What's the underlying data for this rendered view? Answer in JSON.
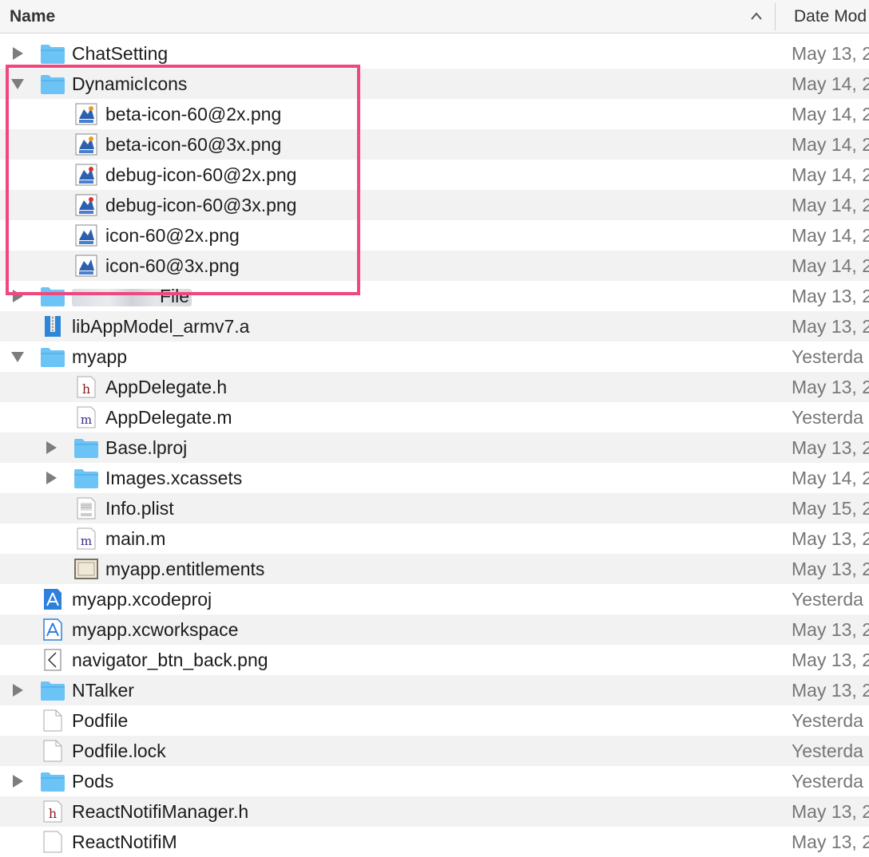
{
  "header": {
    "name_label": "Name",
    "date_label": "Date Mod"
  },
  "rows": [
    {
      "name": "ChatSetting",
      "date": "May 13, 2",
      "icon": "folder-icon",
      "disclosure": "collapsed"
    },
    {
      "name": "DynamicIcons",
      "date": "May 14, 2",
      "icon": "folder-icon",
      "disclosure": "expanded"
    },
    {
      "name": "beta-icon-60@2x.png",
      "date": "May 14, 2",
      "icon": "png-image-icon"
    },
    {
      "name": "beta-icon-60@3x.png",
      "date": "May 14, 2",
      "icon": "png-image-icon"
    },
    {
      "name": "debug-icon-60@2x.png",
      "date": "May 14, 2",
      "icon": "png-image-icon"
    },
    {
      "name": "debug-icon-60@3x.png",
      "date": "May 14, 2",
      "icon": "png-image-icon"
    },
    {
      "name": "icon-60@2x.png",
      "date": "May 14, 2",
      "icon": "png-image-icon"
    },
    {
      "name": "icon-60@3x.png",
      "date": "May 14, 2",
      "icon": "png-image-icon"
    },
    {
      "name": "File",
      "date": "May 13, 2",
      "icon": "folder-icon",
      "disclosure": "collapsed"
    },
    {
      "name": "libAppModel_armv7.a",
      "date": "May 13, 2",
      "icon": "static-library-icon"
    },
    {
      "name": "myapp",
      "date": "Yesterda",
      "icon": "folder-icon",
      "disclosure": "expanded"
    },
    {
      "name": "AppDelegate.h",
      "date": "May 13, 2",
      "icon": "header-file-icon"
    },
    {
      "name": "AppDelegate.m",
      "date": "Yesterda",
      "icon": "objc-source-icon"
    },
    {
      "name": "Base.lproj",
      "date": "May 13, 2",
      "icon": "folder-icon",
      "disclosure": "collapsed"
    },
    {
      "name": "Images.xcassets",
      "date": "May 14, 2",
      "icon": "folder-icon",
      "disclosure": "collapsed"
    },
    {
      "name": "Info.plist",
      "date": "May 15, 2",
      "icon": "plist-file-icon"
    },
    {
      "name": "main.m",
      "date": "May 13, 2",
      "icon": "objc-source-icon"
    },
    {
      "name": "myapp.entitlements",
      "date": "May 13, 2",
      "icon": "entitlements-icon"
    },
    {
      "name": "myapp.xcodeproj",
      "date": "Yesterda",
      "icon": "xcodeproj-icon"
    },
    {
      "name": "myapp.xcworkspace",
      "date": "May 13, 2",
      "icon": "xcworkspace-icon"
    },
    {
      "name": "navigator_btn_back.png",
      "date": "May 13, 2",
      "icon": "back-chevron-image-icon"
    },
    {
      "name": "NTalker",
      "date": "May 13, 2",
      "icon": "folder-icon",
      "disclosure": "collapsed"
    },
    {
      "name": "Podfile",
      "date": "Yesterda",
      "icon": "document-icon"
    },
    {
      "name": "Podfile.lock",
      "date": "Yesterda",
      "icon": "document-icon"
    },
    {
      "name": "Pods",
      "date": "Yesterda",
      "icon": "folder-icon",
      "disclosure": "collapsed"
    },
    {
      "name": "ReactNotifiManager.h",
      "date": "May 13, 2",
      "icon": "header-file-icon"
    },
    {
      "name": "ReactNotifiM",
      "date": "May 13, 2",
      "icon": "objc-source-icon"
    }
  ],
  "colors": {
    "highlight": "#f0487e",
    "folder": "#6cc3f5",
    "row_alt": "#f2f2f2"
  }
}
